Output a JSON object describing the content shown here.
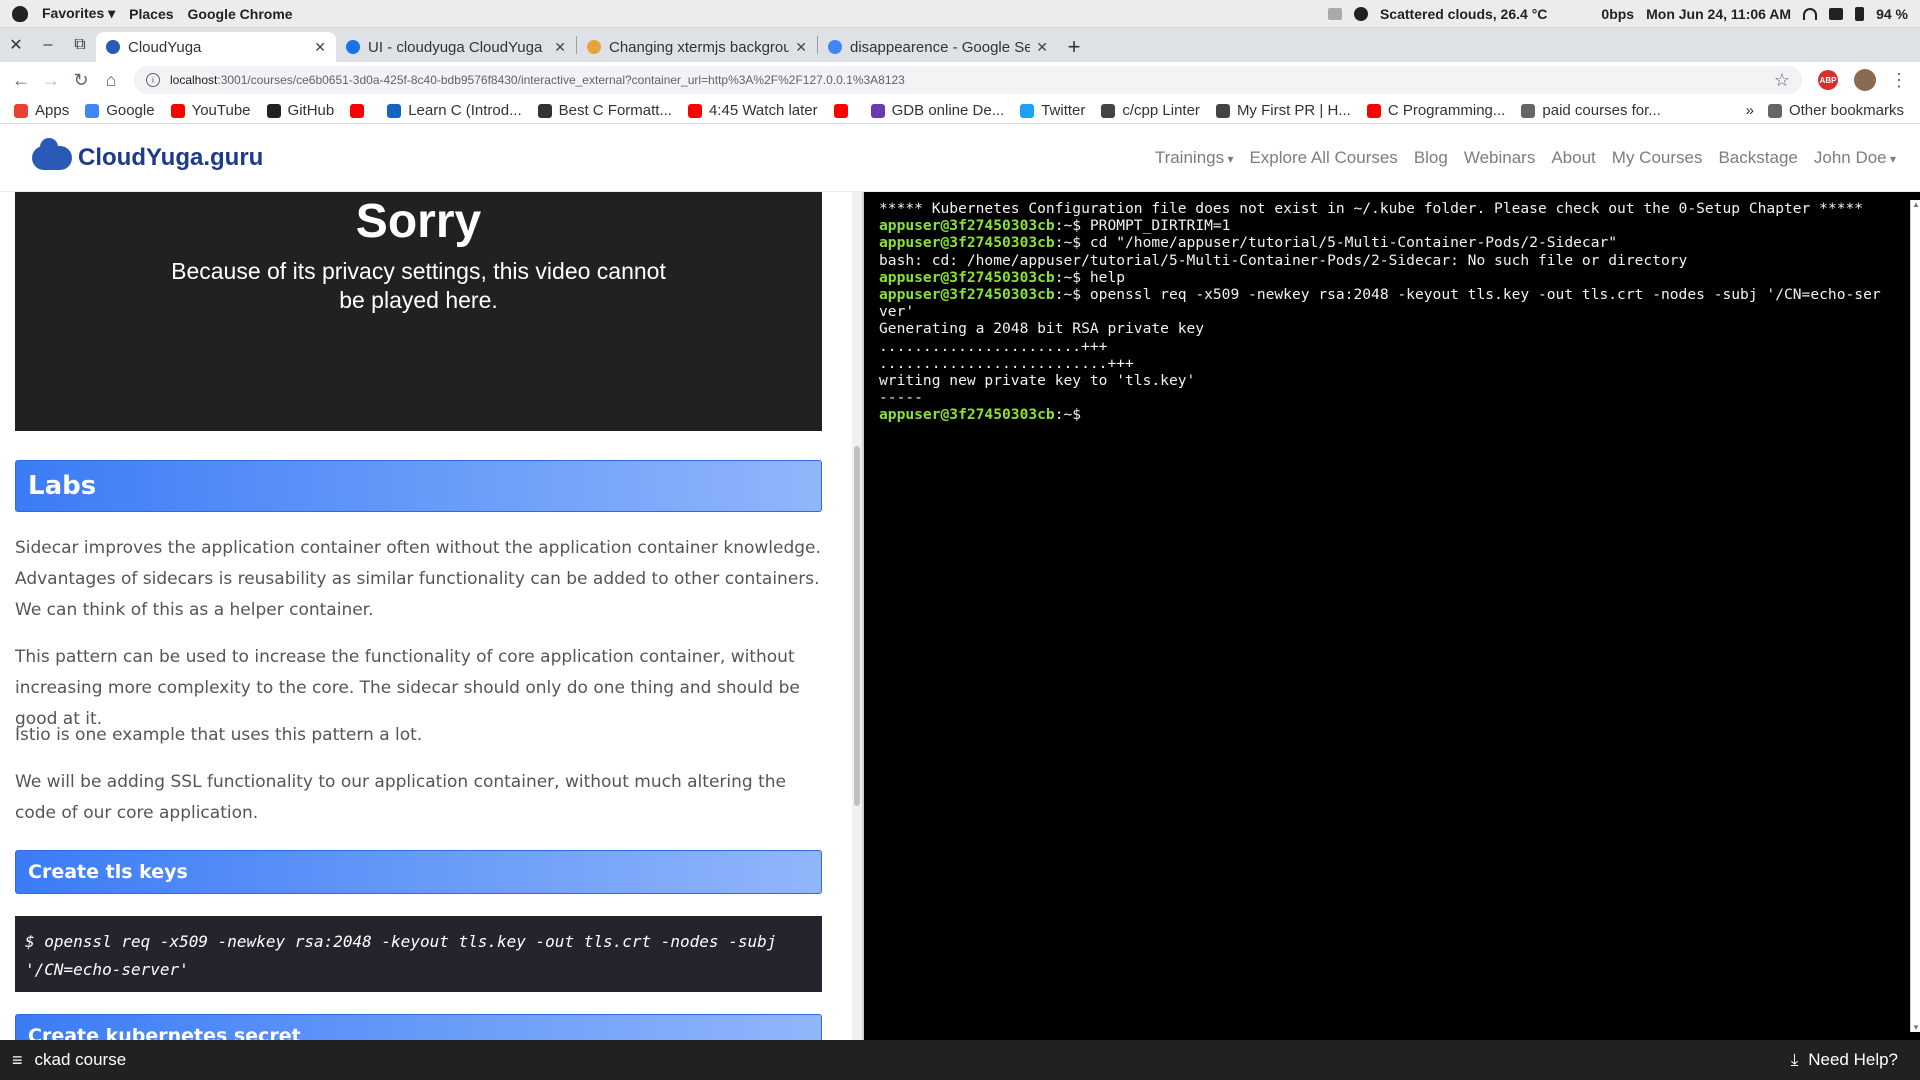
{
  "os": {
    "favorites": "Favorites ▾",
    "places": "Places",
    "app": "Google Chrome",
    "weather": "Scattered clouds, 26.4 °C",
    "net": "0bps",
    "clock": "Mon Jun 24, 11:06 AM",
    "battery": "94 %"
  },
  "tabs": [
    {
      "title": "CloudYuga",
      "color": "#2a5ab7"
    },
    {
      "title": "UI - cloudyuga CloudYuga",
      "color": "#1a73e8"
    },
    {
      "title": "Changing xtermjs backgrou",
      "color": "#e8a33d"
    },
    {
      "title": "disappearence - Google Se",
      "color": "#4285f4"
    }
  ],
  "url": {
    "host": "localhost",
    "path": ":3001/courses/ce6b0651-3d0a-425f-8c40-bdb9576f8430/interactive_external?container_url=http%3A%2F%2F127.0.0.1%3A8123"
  },
  "bookmarks": [
    {
      "label": "Apps",
      "color": "#e94235"
    },
    {
      "label": "Google",
      "color": "#4285f4"
    },
    {
      "label": "YouTube",
      "color": "#ff0000"
    },
    {
      "label": "GitHub",
      "color": "#222222"
    },
    {
      "label": "",
      "color": "#ff0000"
    },
    {
      "label": "Learn C (Introd...",
      "color": "#1565c0"
    },
    {
      "label": "Best C Formatt...",
      "color": "#333333"
    },
    {
      "label": "4:45 Watch later",
      "color": "#ff0000"
    },
    {
      "label": "",
      "color": "#ff0000"
    },
    {
      "label": "GDB online De...",
      "color": "#6a3ab2"
    },
    {
      "label": "Twitter",
      "color": "#1da1f2"
    },
    {
      "label": "c/cpp Linter",
      "color": "#444444"
    },
    {
      "label": "My First PR | H...",
      "color": "#444444"
    },
    {
      "label": "C Programming...",
      "color": "#ff0000"
    },
    {
      "label": "paid courses for...",
      "color": "#666666"
    }
  ],
  "bookmarks_more": "»",
  "other_bookmarks": "Other bookmarks",
  "site": {
    "logo": "CloudYuga.guru",
    "nav": [
      "Trainings",
      "Explore All Courses",
      "Blog",
      "Webinars",
      "About",
      "My Courses",
      "Backstage",
      "John Doe"
    ]
  },
  "video": {
    "title": "Sorry",
    "message": "Because of its privacy settings, this video cannot be played here."
  },
  "content": {
    "labs_heading": "Labs",
    "p1": "Sidecar improves the application container often without the application container knowledge. Advantages of sidecars is reusability as similar functionality can be added to other containers. We can think of this as a helper container.",
    "p2": "This pattern can be used to increase the functionality of core application container, without increasing more complexity to the core. The sidecar should only do one thing and should be good at it.",
    "p3": "Istio is one example that uses this pattern a lot.",
    "p4": "We will be adding SSL functionality to our application container, without much altering the code of our core application.",
    "tls_heading": "Create tls keys",
    "code": "$ openssl req -x509 -newkey rsa:2048 -keyout tls.key -out tls.crt -nodes -subj '/CN=echo-server'",
    "secret_heading": "Create kubernetes secret"
  },
  "terminal": {
    "lines": [
      {
        "prompt": "",
        "text": "***** Kubernetes Configuration file does not exist in ~/.kube folder. Please check out the 0-Setup Chapter *****"
      },
      {
        "prompt": "appuser@3f27450303cb",
        "text": ":~$ PROMPT_DIRTRIM=1"
      },
      {
        "prompt": "appuser@3f27450303cb",
        "text": ":~$ cd \"/home/appuser/tutorial/5-Multi-Container-Pods/2-Sidecar\""
      },
      {
        "prompt": "",
        "text": "bash: cd: /home/appuser/tutorial/5-Multi-Container-Pods/2-Sidecar: No such file or directory"
      },
      {
        "prompt": "appuser@3f27450303cb",
        "text": ":~$ help"
      },
      {
        "prompt": "appuser@3f27450303cb",
        "text": ":~$ openssl req -x509 -newkey rsa:2048 -keyout tls.key -out tls.crt -nodes -subj '/CN=echo-ser"
      },
      {
        "prompt": "",
        "text": "ver'"
      },
      {
        "prompt": "",
        "text": "Generating a 2048 bit RSA private key"
      },
      {
        "prompt": "",
        "text": ".......................+++"
      },
      {
        "prompt": "",
        "text": "..........................+++"
      },
      {
        "prompt": "",
        "text": "writing new private key to 'tls.key'"
      },
      {
        "prompt": "",
        "text": "-----"
      },
      {
        "prompt": "appuser@3f27450303cb",
        "text": ":~$"
      }
    ]
  },
  "footer": {
    "menu_icon": "≡",
    "course": "ckad course",
    "help": "Need Help?"
  }
}
